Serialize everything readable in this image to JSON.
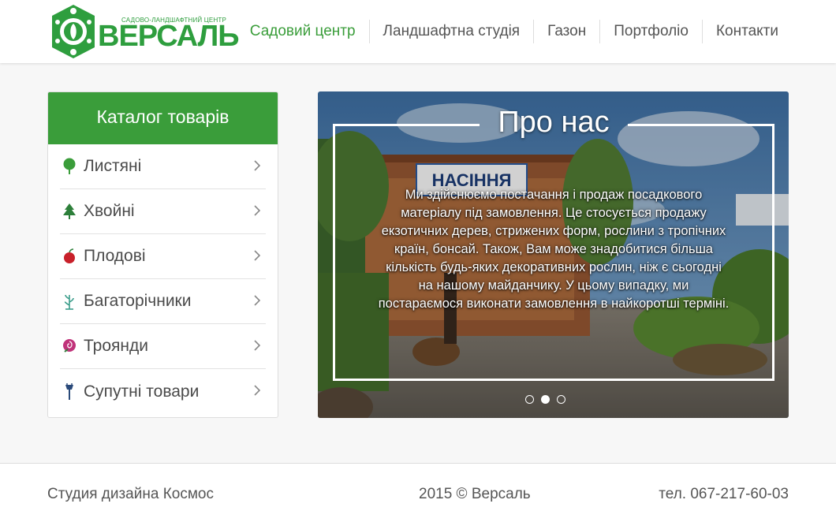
{
  "header": {
    "logo": {
      "subtitle": "САДОВО-ЛАНДШАФТНИЙ ЦЕНТР",
      "name": "ВЕРСАЛЬ"
    },
    "nav": [
      {
        "label": "Садовий центр",
        "active": true
      },
      {
        "label": "Ландшафтна студія",
        "active": false
      },
      {
        "label": "Газон",
        "active": false
      },
      {
        "label": "Портфоліо",
        "active": false
      },
      {
        "label": "Контакти",
        "active": false
      }
    ]
  },
  "catalog": {
    "title": "Каталог товарів",
    "items": [
      {
        "label": "Листяні",
        "icon": "deciduous-tree-icon"
      },
      {
        "label": "Хвойні",
        "icon": "conifer-tree-icon"
      },
      {
        "label": "Плодові",
        "icon": "apple-icon"
      },
      {
        "label": "Багаторічники",
        "icon": "perennial-plant-icon"
      },
      {
        "label": "Троянди",
        "icon": "rose-icon"
      },
      {
        "label": "Супутні товари",
        "icon": "garden-tools-icon"
      }
    ]
  },
  "slider": {
    "title": "Про нас",
    "text": "Ми здійснюємо постачання і продаж посадкового матеріалу під замовлення. Це стосується продажу екзотичних дерев, стрижених форм, рослини з тропічних країн, бонсай. Також, Вам може знадобитися більша кількість будь-яких декоративних рослин, ніж є сьогодні на нашому майданчику. У цьому випадку, ми постараємося виконати замовлення в найкоротші терміні.",
    "sign_text": "НАСІННЯ",
    "active_dot": 2,
    "dot_count": 3
  },
  "footer": {
    "left": "Студия дизайна Космос",
    "center": "2015 © Версаль",
    "right": "тел. 067-217-60-03"
  },
  "colors": {
    "accent": "#3a9d3a",
    "logo_green": "#2e9e3e"
  }
}
